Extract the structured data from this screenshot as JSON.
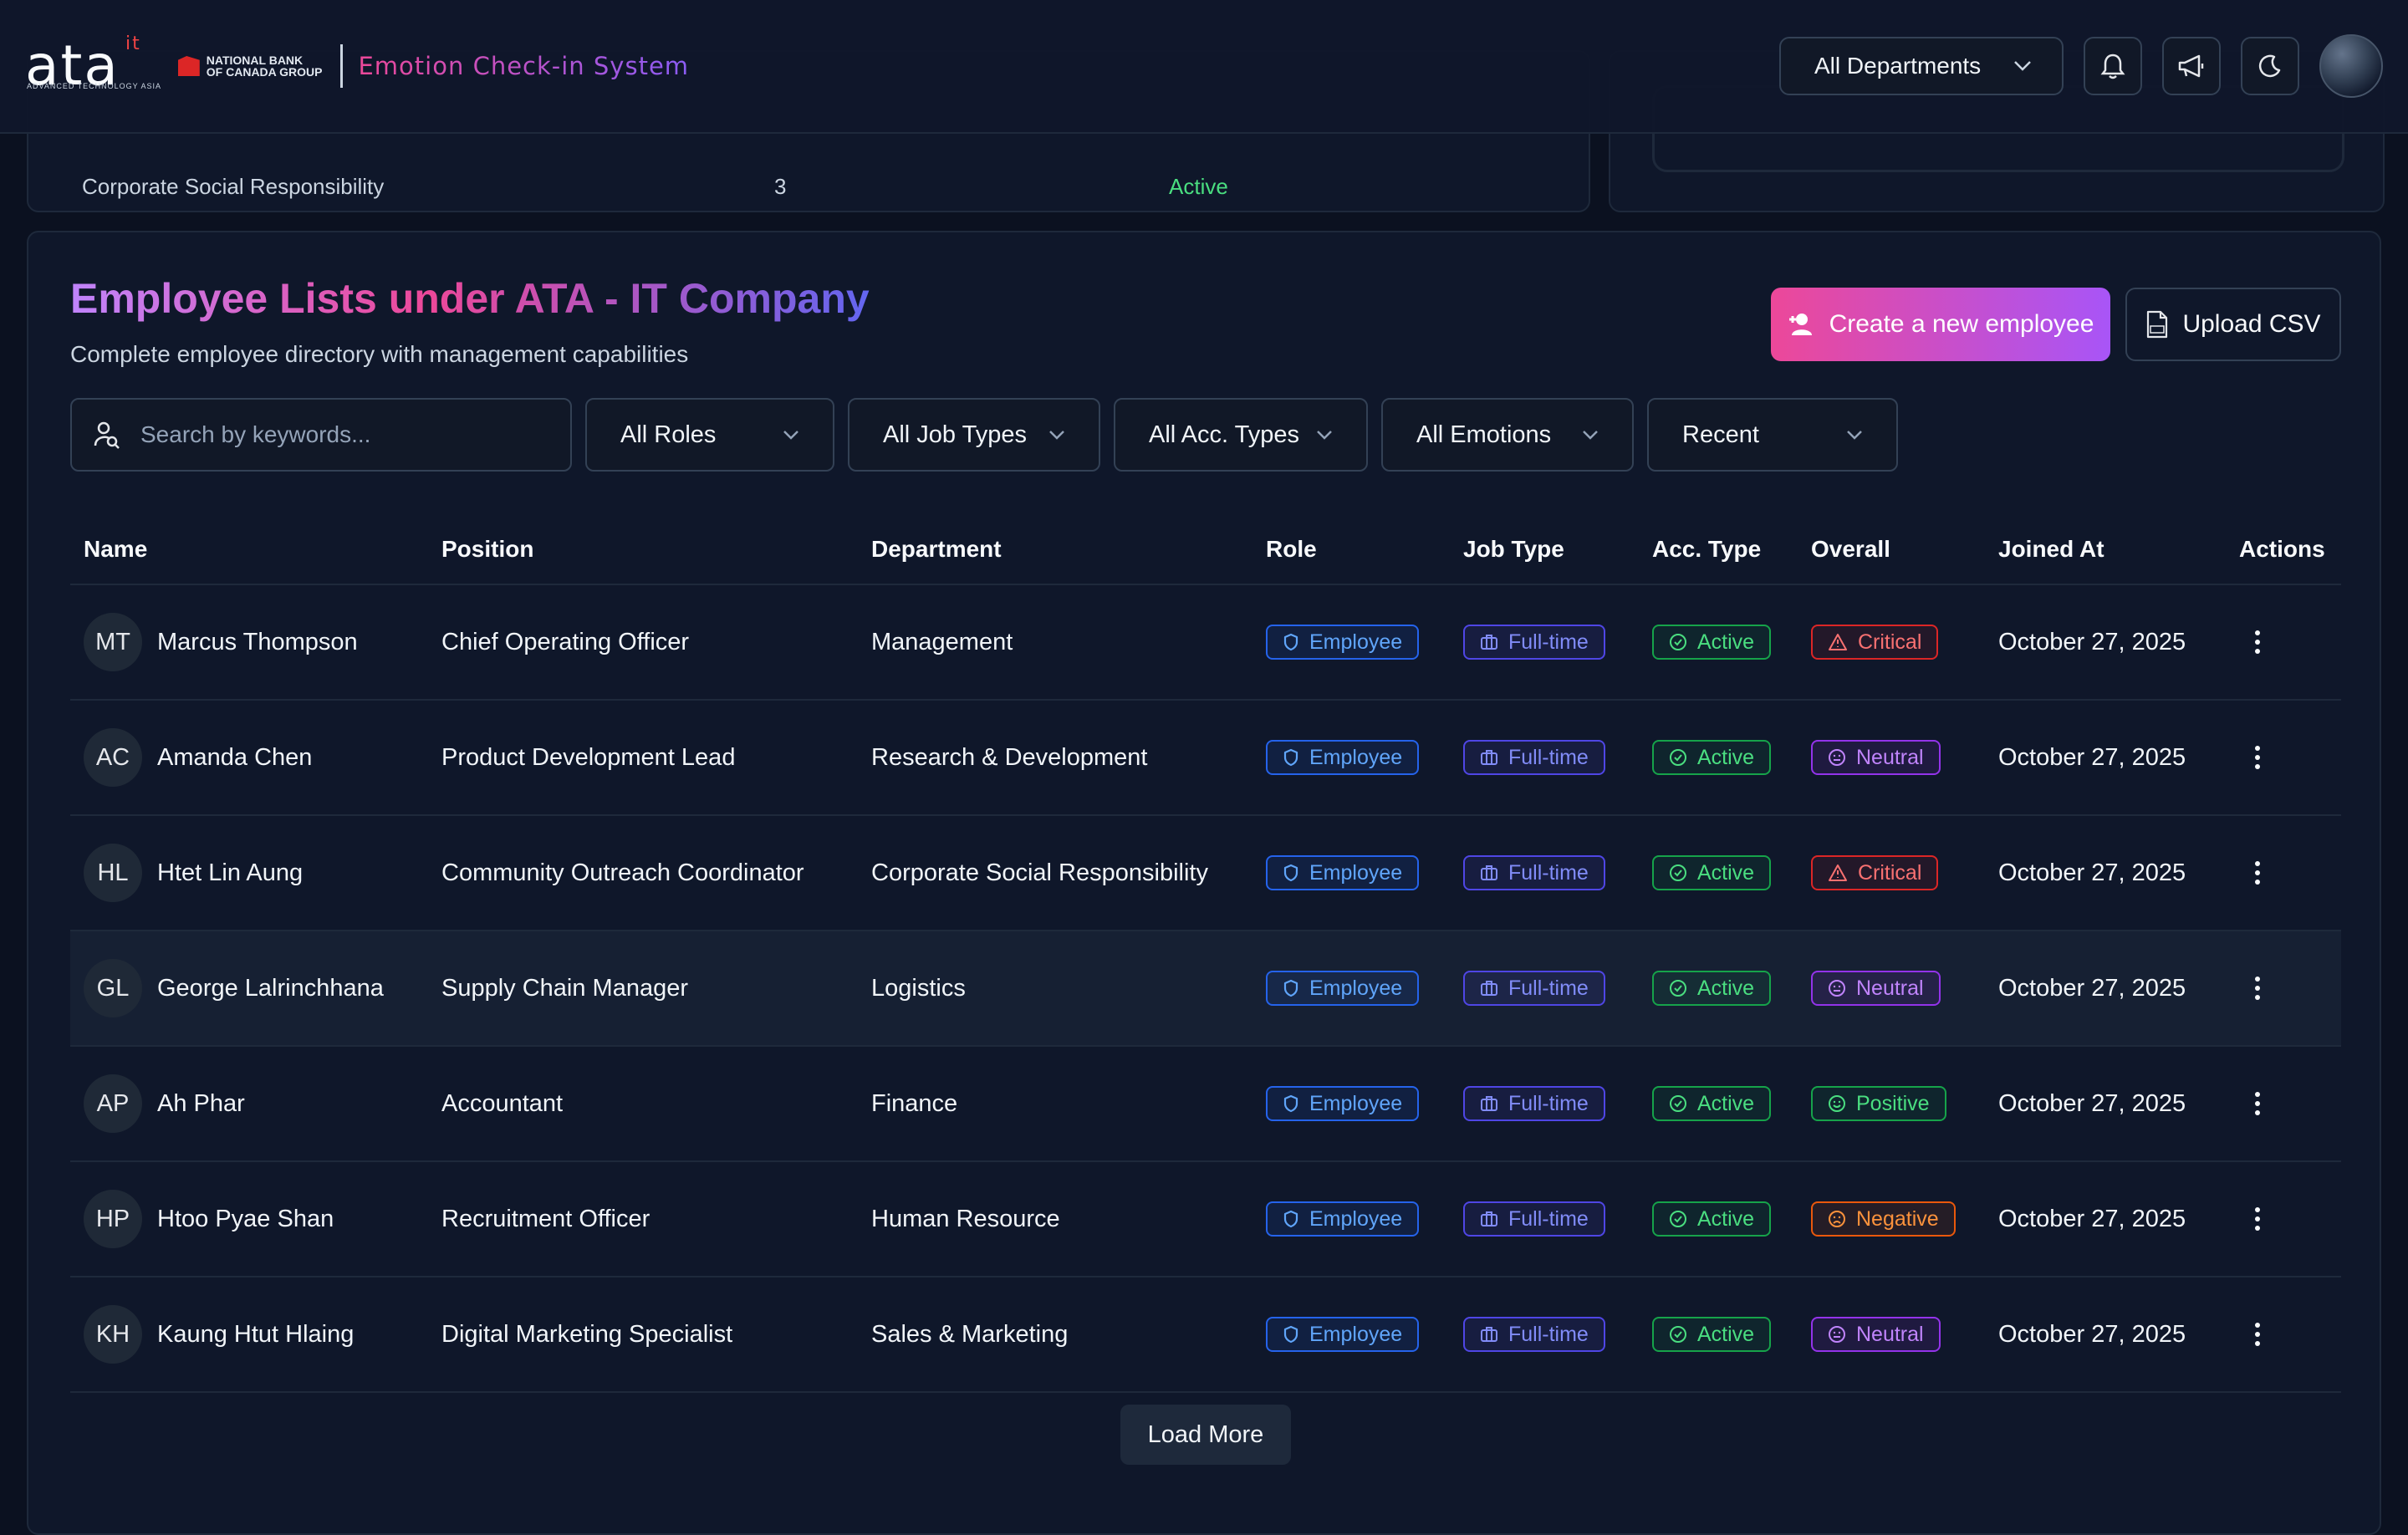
{
  "header": {
    "logo_text": "ata",
    "logo_sup": "it",
    "logo_sub": "ADVANCED TECHNOLOGY ASIA",
    "partner_line1": "NATIONAL BANK",
    "partner_line2": "OF CANADA GROUP",
    "app_name": "Emotion Check-in System",
    "department_select": "All Departments"
  },
  "remnant": {
    "row_name": "Corporate Social Responsibility",
    "row_count": "3",
    "row_status": "Active"
  },
  "main": {
    "title": "Employee Lists under ATA - IT Company",
    "subtitle": "Complete employee directory with management capabilities",
    "create_label": "Create a new employee",
    "upload_label": "Upload CSV",
    "search_placeholder": "Search by keywords...",
    "filters": {
      "roles": "All Roles",
      "job_types": "All Job Types",
      "acc_types": "All Acc. Types",
      "emotions": "All Emotions",
      "sort": "Recent"
    },
    "columns": [
      "Name",
      "Position",
      "Department",
      "Role",
      "Job Type",
      "Acc. Type",
      "Overall",
      "Joined At",
      "Actions"
    ],
    "rows": [
      {
        "initials": "MT",
        "name": "Marcus Thompson",
        "position": "Chief Operating Officer",
        "department": "Management",
        "role": "Employee",
        "job_type": "Full-time",
        "acc_type": "Active",
        "overall": "Critical",
        "joined": "October 27, 2025"
      },
      {
        "initials": "AC",
        "name": "Amanda Chen",
        "position": "Product Development Lead",
        "department": "Research & Development",
        "role": "Employee",
        "job_type": "Full-time",
        "acc_type": "Active",
        "overall": "Neutral",
        "joined": "October 27, 2025"
      },
      {
        "initials": "HL",
        "name": "Htet Lin Aung",
        "position": "Community Outreach Coordinator",
        "department": "Corporate Social Responsibility",
        "role": "Employee",
        "job_type": "Full-time",
        "acc_type": "Active",
        "overall": "Critical",
        "joined": "October 27, 2025"
      },
      {
        "initials": "GL",
        "name": "George Lalrinchhana",
        "position": "Supply Chain Manager",
        "department": "Logistics",
        "role": "Employee",
        "job_type": "Full-time",
        "acc_type": "Active",
        "overall": "Neutral",
        "joined": "October 27, 2025"
      },
      {
        "initials": "AP",
        "name": "Ah Phar",
        "position": "Accountant",
        "department": "Finance",
        "role": "Employee",
        "job_type": "Full-time",
        "acc_type": "Active",
        "overall": "Positive",
        "joined": "October 27, 2025"
      },
      {
        "initials": "HP",
        "name": "Htoo Pyae Shan",
        "position": "Recruitment Officer",
        "department": "Human Resource",
        "role": "Employee",
        "job_type": "Full-time",
        "acc_type": "Active",
        "overall": "Negative",
        "joined": "October 27, 2025"
      },
      {
        "initials": "KH",
        "name": "Kaung Htut Hlaing",
        "position": "Digital Marketing Specialist",
        "department": "Sales & Marketing",
        "role": "Employee",
        "job_type": "Full-time",
        "acc_type": "Active",
        "overall": "Neutral",
        "joined": "October 27, 2025"
      }
    ],
    "load_more": "Load More"
  },
  "colors": {
    "background": "#0b1120",
    "card": "#0f172a",
    "accent_pink": "#ec4899",
    "accent_purple": "#a855f7",
    "critical": "#f87171",
    "neutral": "#c084fc",
    "positive": "#4ade80",
    "negative": "#fb923c"
  }
}
